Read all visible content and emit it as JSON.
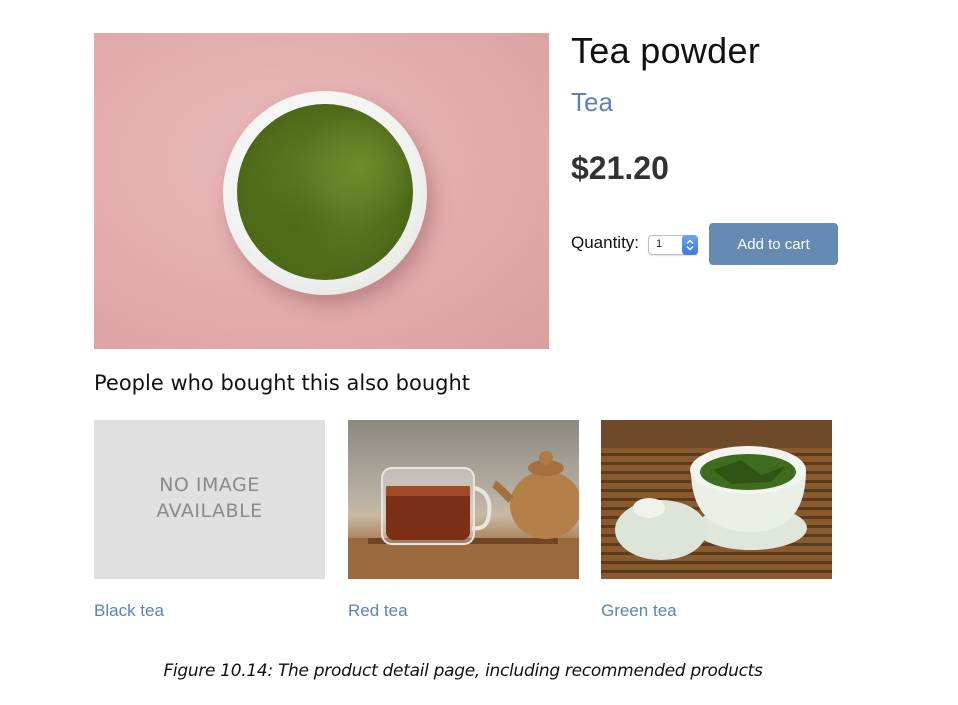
{
  "product": {
    "title": "Tea powder",
    "category": "Tea",
    "price": "$21.20",
    "quantity_label": "Quantity:",
    "quantity_value": "1",
    "add_to_cart_label": "Add to cart"
  },
  "recommendations": {
    "heading": "People who bought this also bought",
    "no_image_line1": "NO IMAGE",
    "no_image_line2": "AVAILABLE",
    "items": [
      {
        "name": "Black tea"
      },
      {
        "name": "Red tea"
      },
      {
        "name": "Green tea"
      }
    ]
  },
  "caption": "Figure 10.14: The product detail page, including recommended products",
  "colors": {
    "link": "#5b84b1",
    "button": "#658ab3",
    "button_text": "#ffffff"
  }
}
